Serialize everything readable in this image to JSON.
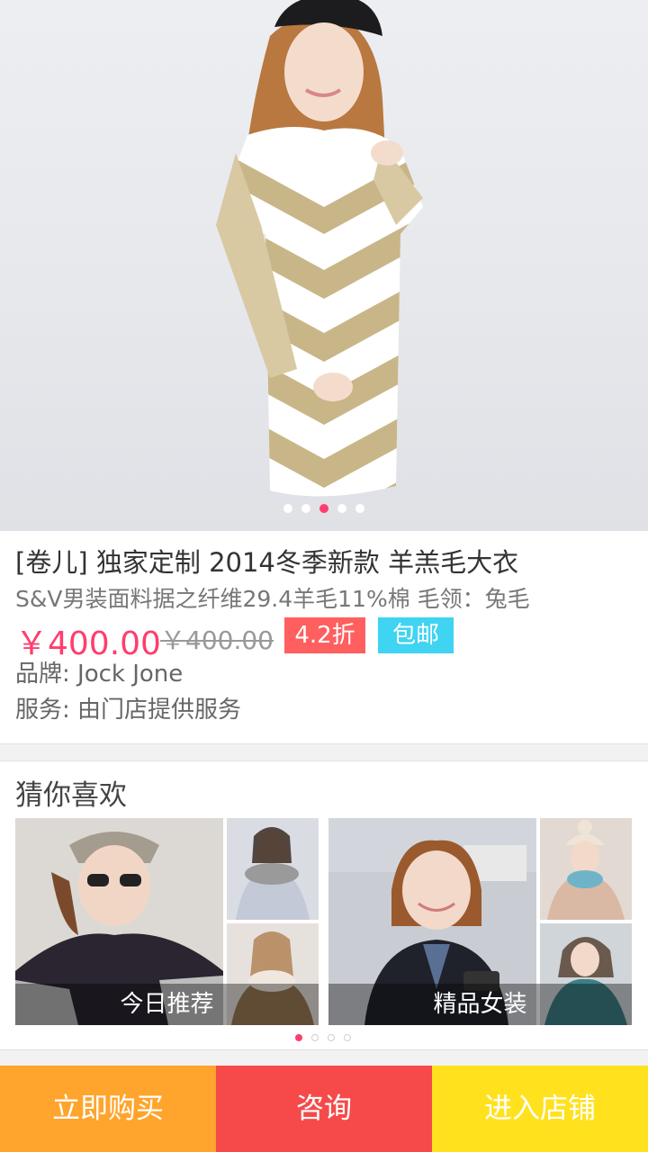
{
  "product": {
    "title": "[卷儿] 独家定制 2014冬季新款 羊羔毛大衣",
    "subtitle": "S&V男装面料据之纤维29.4羊毛11%棉 毛领：兔毛",
    "price": "￥400.00",
    "original_price": "￥400.00",
    "discount_badge": "4.2折",
    "shipping_badge": "包邮",
    "brand": "品牌: Jock Jone",
    "service": "服务: 由门店提供服务",
    "carousel": {
      "total": 5,
      "active_index": 2
    }
  },
  "recommend": {
    "title": "猜你喜欢",
    "cards": [
      {
        "caption": "今日推荐"
      },
      {
        "caption": "精品女装"
      }
    ],
    "pager": {
      "total": 4,
      "active_index": 0
    }
  },
  "actions": {
    "buy_now": "立即购买",
    "consult": "咨询",
    "enter_store": "进入店铺"
  },
  "colors": {
    "accent_pink": "#ff3d6e",
    "discount_red": "#ff5f5f",
    "shipping_cyan": "#3fd4f1",
    "buy_orange": "#ffa42c",
    "consult_red": "#f64a4a",
    "store_yellow": "#ffe11e"
  }
}
